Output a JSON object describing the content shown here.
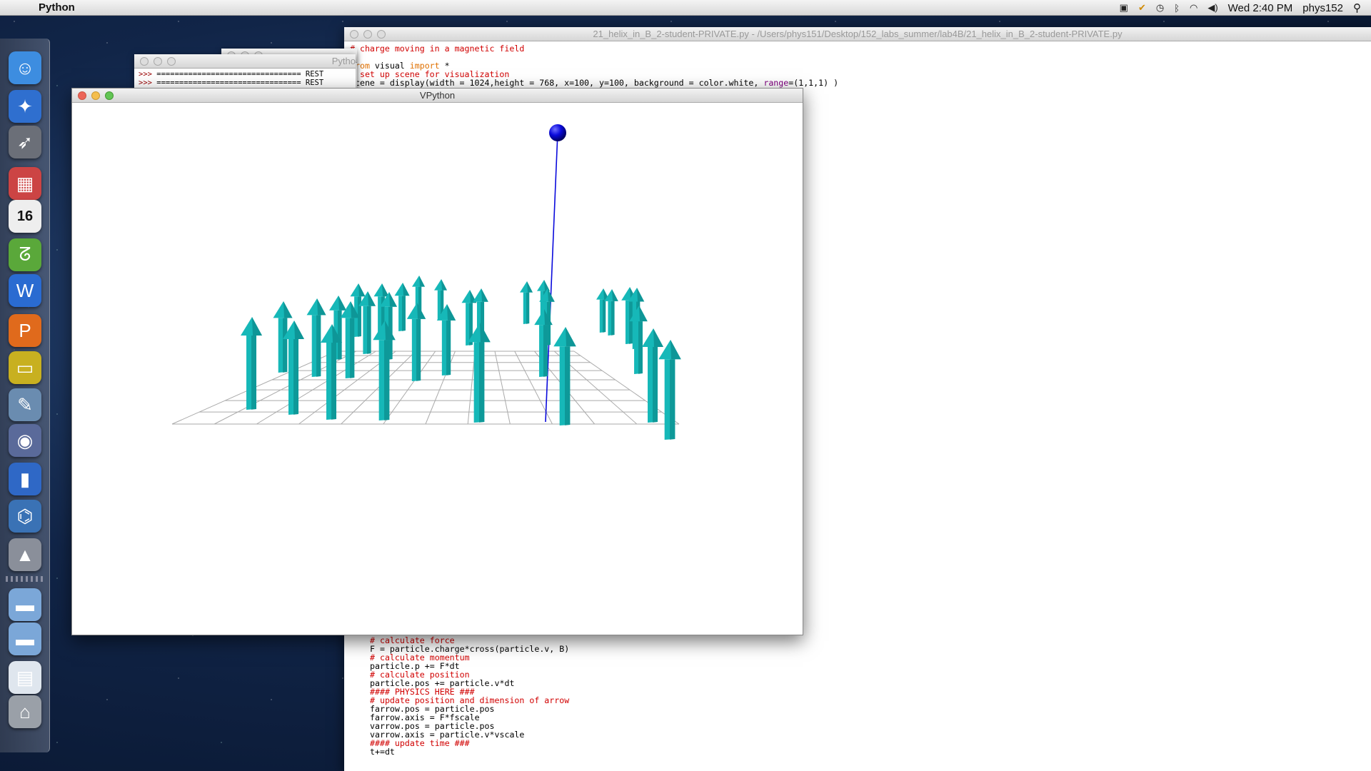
{
  "menubar": {
    "app_name": "Python",
    "clock": "Wed 2:40 PM",
    "user": "phys152"
  },
  "dock": {
    "items": [
      {
        "name": "finder",
        "glyph": "☺",
        "color": "#3d8de0"
      },
      {
        "name": "safari",
        "glyph": "✦",
        "color": "#2f6fcf"
      },
      {
        "name": "launchpad",
        "glyph": "➶",
        "color": "#6b6f78"
      },
      {
        "name": "photo-booth",
        "glyph": "▦",
        "color": "#c44"
      },
      {
        "name": "calendar",
        "glyph": "16",
        "color": "#eeeeee"
      },
      {
        "name": "logger-app",
        "glyph": "ᘔ",
        "color": "#5aa83a"
      },
      {
        "name": "word",
        "glyph": "W",
        "color": "#2a6bd1"
      },
      {
        "name": "powerpoint",
        "glyph": "P",
        "color": "#e06a1c"
      },
      {
        "name": "logger-device",
        "glyph": "▭",
        "color": "#c8b020"
      },
      {
        "name": "preview",
        "glyph": "✎",
        "color": "#6a8cb0"
      },
      {
        "name": "vpn",
        "glyph": "◉",
        "color": "#5a6a9a"
      },
      {
        "name": "audio",
        "glyph": "▮",
        "color": "#2f68c6"
      },
      {
        "name": "python-launcher",
        "glyph": "⌬",
        "color": "#3a72b5"
      },
      {
        "name": "rocket",
        "glyph": "▲",
        "color": "#8a8f9a"
      },
      {
        "name": "folder-1",
        "glyph": "▬",
        "color": "#7ba7d8"
      },
      {
        "name": "folder-2",
        "glyph": "▬",
        "color": "#7ba7d8"
      },
      {
        "name": "documents",
        "glyph": "▤",
        "color": "#dfe6ee"
      },
      {
        "name": "trash",
        "glyph": "⌂",
        "color": "#9aa0a8"
      }
    ]
  },
  "editor": {
    "title": "21_helix_in_B_2-student-PRIVATE.py - /Users/phys151/Desktop/152_labs_summer/lab4B/21_helix_in_B_2-student-PRIVATE.py",
    "top_lines": [
      {
        "text": "# charge moving in a magnetic field",
        "cls": "c"
      },
      {
        "text": "#",
        "cls": "c"
      },
      {
        "html": "<span class=\"k\">from</span> visual <span class=\"k\">import</span> *"
      },
      {
        "text": "# set up scene for visualization",
        "cls": "c"
      },
      {
        "html": "scene = display(width = 1024,height = 768, x=100, y=100, background = color.white, <span class=\"b\">range</span>=(1,1,1) )"
      }
    ],
    "bottom_lines": [
      {
        "text": "# calculate force",
        "cls": "c"
      },
      {
        "text": "F = particle.charge*cross(particle.v, B)"
      },
      {
        "text": "# calculate momentum",
        "cls": "c"
      },
      {
        "text": "particle.p += F*dt"
      },
      {
        "text": "# calculate position",
        "cls": "c"
      },
      {
        "text": "particle.pos += particle.v*dt"
      },
      {
        "text": "#### PHYSICS HERE ###",
        "cls": "c"
      },
      {
        "text": "# update position and dimension of arrow",
        "cls": "c"
      },
      {
        "text": "farrow.pos = particle.pos"
      },
      {
        "text": "farrow.axis = F*fscale"
      },
      {
        "text": "varrow.pos = particle.pos"
      },
      {
        "text": "varrow.axis = particle.v*vscale"
      },
      {
        "text": "#### update time ###",
        "cls": "c"
      },
      {
        "text": "t+=dt"
      }
    ]
  },
  "shell": {
    "title": "Pytho",
    "lines": [
      ">>> ================================ REST",
      ">>> ================================ REST"
    ]
  },
  "vpython": {
    "title": "VPython",
    "colors": {
      "arrow": "#16b8b8",
      "arrow_dark": "#0a7f80",
      "ball": "#0a0adc",
      "grid": "#aaaaaa"
    }
  }
}
